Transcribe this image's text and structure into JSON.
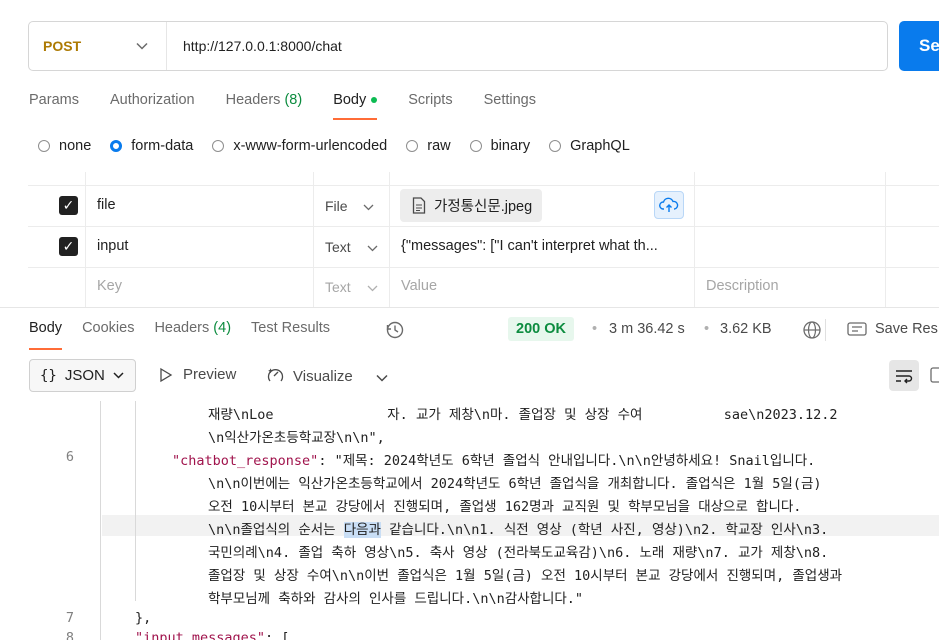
{
  "request": {
    "method": "POST",
    "url": "http://127.0.0.1:8000/chat",
    "send_label": "Se"
  },
  "request_tabs": [
    {
      "label": "Params"
    },
    {
      "label": "Authorization"
    },
    {
      "label": "Headers",
      "count": "(8)"
    },
    {
      "label": "Body"
    },
    {
      "label": "Scripts"
    },
    {
      "label": "Settings"
    }
  ],
  "body_types": [
    "none",
    "form-data",
    "x-www-form-urlencoded",
    "raw",
    "binary",
    "GraphQL"
  ],
  "selected_body_type": "form-data",
  "form_rows": [
    {
      "key": "file",
      "type": "File",
      "value": "가정통신문.jpeg"
    },
    {
      "key": "input",
      "type": "Text",
      "value": "{\"messages\": [\"I can't interpret what th..."
    }
  ],
  "form_placeholder": {
    "key": "Key",
    "type": "Text",
    "value": "Value",
    "description": "Description"
  },
  "response_tabs": [
    {
      "label": "Body"
    },
    {
      "label": "Cookies"
    },
    {
      "label": "Headers",
      "count": "(4)"
    },
    {
      "label": "Test Results"
    }
  ],
  "response_meta": {
    "status": "200 OK",
    "time": "3 m 36.42 s",
    "size": "3.62 KB",
    "save_label": "Save Res"
  },
  "response_toolbar": {
    "format": "JSON",
    "preview": "Preview",
    "visualize": "Visualize"
  },
  "code_lines": [
    {
      "num": "",
      "text": "재량\\nLoe              자. 교가 제창\\n마. 졸업장 및 상장 수여          sae\\n2023.12.2"
    },
    {
      "num": "",
      "text": "\\n익산가온초등학교장\\n\\n\","
    },
    {
      "num": "6",
      "key": "\"chatbot_response\"",
      "text": ": \"제목: 2024학년도 6학년 졸업식 안내입니다.\\n\\n안녕하세요! Snail입니다."
    },
    {
      "num": "",
      "text": "\\n\\n이번에는 익산가온초등학교에서 2024학년도 6학년 졸업식을 개최합니다. 졸업식은 1월 5일(금)"
    },
    {
      "num": "",
      "text": "오전 10시부터 본교 강당에서 진행되며, 졸업생 162명과 교직원 및 학부모님을 대상으로 합니다."
    },
    {
      "num": "",
      "pre": "\\n\\n졸업식의 순서는 ",
      "selected": "다음과",
      "text": " 같습니다.\\n\\n1. 식전 영상 (학년 사진, 영상)\\n2. 학교장 인사\\n3."
    },
    {
      "num": "",
      "text": "국민의례\\n4. 졸업 축하 영상\\n5. 축사 영상 (전라북도교육감)\\n6. 노래 재량\\n7. 교가 제창\\n8."
    },
    {
      "num": "",
      "text": "졸업장 및 상장 수여\\n\\n이번 졸업식은 1월 5일(금) 오전 10시부터 본교 강당에서 진행되며, 졸업생과"
    },
    {
      "num": "",
      "text": "학부모님께 축하와 감사의 인사를 드립니다.\\n\\n감사합니다.\""
    },
    {
      "num": "7",
      "text": "},"
    },
    {
      "num": "8",
      "key": "\"input_messages\"",
      "text": ": ["
    }
  ]
}
